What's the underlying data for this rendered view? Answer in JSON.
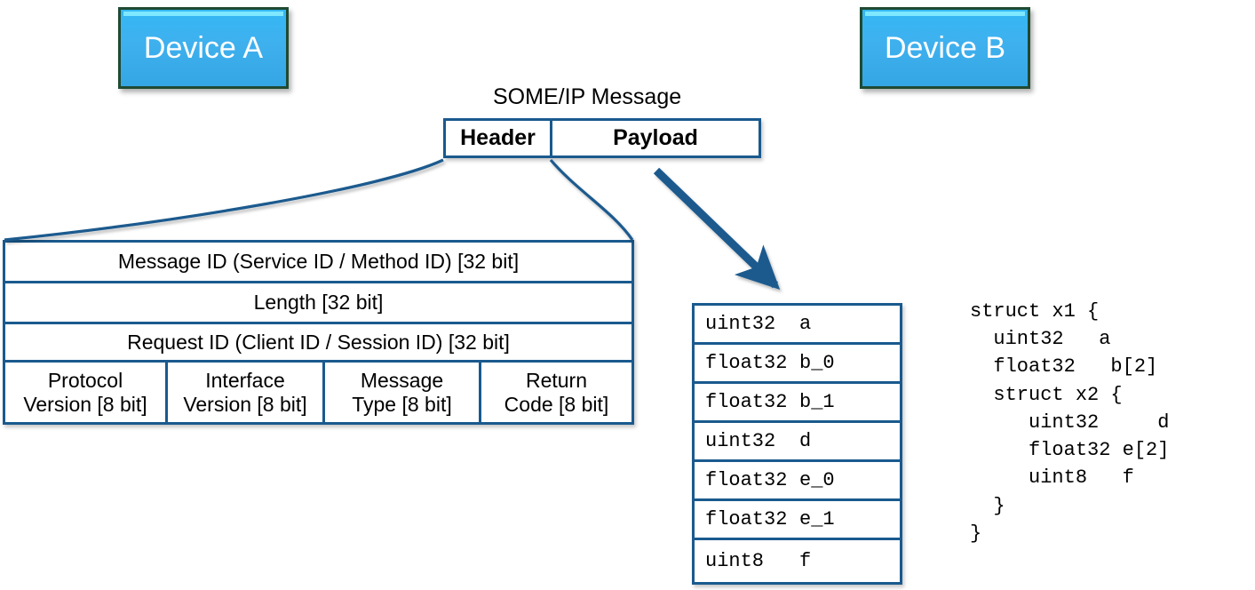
{
  "diagram": {
    "title": "SOME/IP Message",
    "devices": [
      {
        "label": "Device A"
      },
      {
        "label": "Device B"
      }
    ],
    "message_parts": [
      {
        "label": "Header"
      },
      {
        "label": "Payload"
      }
    ],
    "header_fields": [
      {
        "label": "Message ID (Service ID / Method ID) [32 bit]"
      },
      {
        "label": "Length [32 bit]"
      },
      {
        "label": "Request ID (Client ID / Session ID) [32 bit]"
      }
    ],
    "header_byte_fields": [
      {
        "line1": "Protocol",
        "line2": "Version [8 bit]"
      },
      {
        "line1": "Interface",
        "line2": "Version [8 bit]"
      },
      {
        "line1": "Message",
        "line2": "Type [8 bit]"
      },
      {
        "line1": "Return",
        "line2": "Code [8 bit]"
      }
    ],
    "payload_rows": [
      {
        "type": "uint32",
        "name": "a"
      },
      {
        "type": "float32",
        "name": "b_0"
      },
      {
        "type": "float32",
        "name": "b_1"
      },
      {
        "type": "uint32",
        "name": "d"
      },
      {
        "type": "float32",
        "name": "e_0"
      },
      {
        "type": "float32",
        "name": "e_1"
      },
      {
        "type": "uint8",
        "name": "f"
      }
    ],
    "struct_code": "struct x1 {\n  uint32   a\n  float32   b[2]\n  struct x2 {\n     uint32     d\n     float32 e[2]\n     uint8   f\n  }\n}",
    "colors": {
      "device_fill": "#3fb0ee",
      "device_border": "#1f4a33",
      "device_highlight": "#7fe8ff",
      "table_border": "#1a5a8e",
      "arrow": "#1a5a8e",
      "text": "#000000",
      "device_text": "#ffffff"
    }
  }
}
